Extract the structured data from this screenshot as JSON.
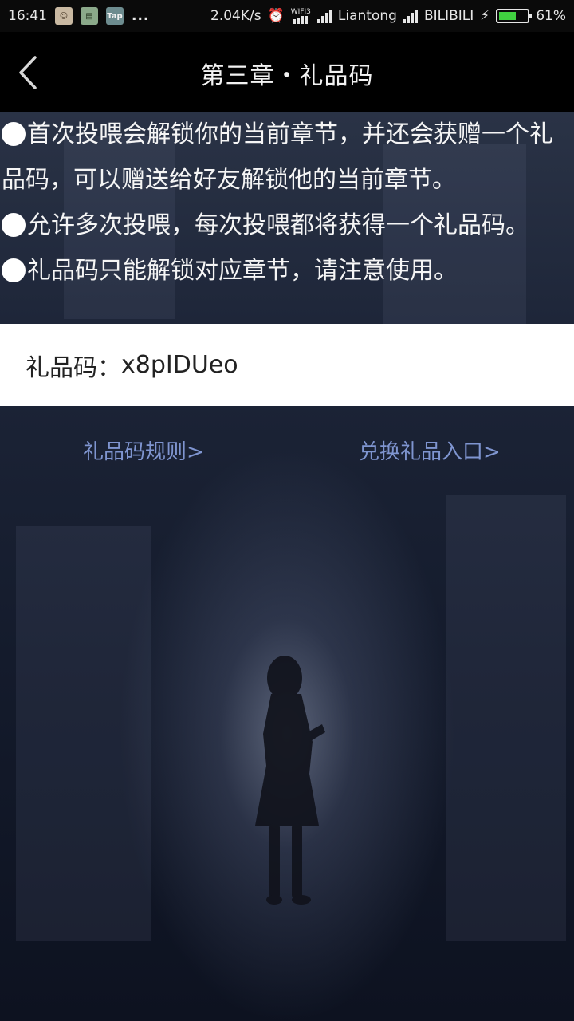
{
  "status_bar": {
    "time": "16:41",
    "net_speed": "2.04K/s",
    "wifi_label": "WIFI3",
    "carrier1": "Liantong",
    "carrier2": "BILIBILI",
    "battery": "61%",
    "battery_level": 0.61,
    "tap_icon_label": "Tap",
    "more": "..."
  },
  "header": {
    "title": "第三章・礼品码"
  },
  "rules": [
    "首次投喂会解锁你的当前章节，并还会获赠一个礼品码，可以赠送给好友解锁他的当前章节。",
    "允许多次投喂，每次投喂都将获得一个礼品码。",
    "礼品码只能解锁对应章节，请注意使用。"
  ],
  "gift_code": {
    "label": "礼品码：",
    "value": "x8pIDUeo"
  },
  "links": {
    "rules": "礼品码规则>",
    "redeem": "兑换礼品入口>"
  },
  "colors": {
    "link": "#7f95d0",
    "header_bg": "#000000",
    "battery_fill": "#40d040"
  }
}
